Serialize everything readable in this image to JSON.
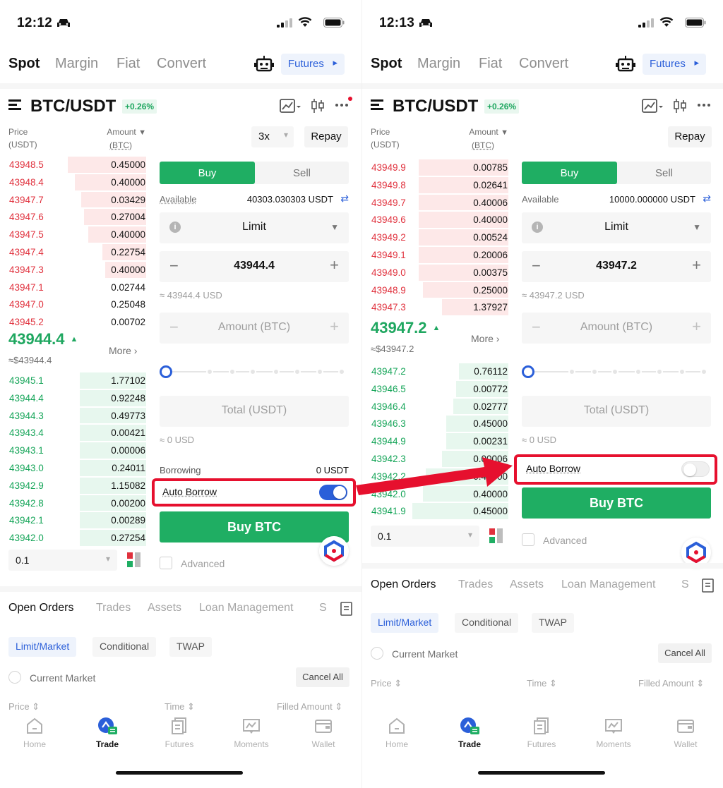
{
  "left": {
    "status_time": "12:12",
    "nav": {
      "tabs": [
        "Spot",
        "Margin",
        "Fiat",
        "Convert"
      ],
      "futures_label": "Futures"
    },
    "pair": "BTC/USDT",
    "change": "+0.26%",
    "orderbook_header": {
      "price_label": "Price",
      "price_unit": "(USDT)",
      "amount_label": "Amount",
      "amount_unit": "(BTC)"
    },
    "asks": [
      {
        "price": "43948.5",
        "amount": "0.45000",
        "depth": 0.57
      },
      {
        "price": "43948.4",
        "amount": "0.40000",
        "depth": 0.52
      },
      {
        "price": "43947.7",
        "amount": "0.03429",
        "depth": 0.47
      },
      {
        "price": "43947.6",
        "amount": "0.27004",
        "depth": 0.45
      },
      {
        "price": "43947.5",
        "amount": "0.40000",
        "depth": 0.42
      },
      {
        "price": "43947.4",
        "amount": "0.22754",
        "depth": 0.32
      },
      {
        "price": "43947.3",
        "amount": "0.40000",
        "depth": 0.3
      },
      {
        "price": "43947.1",
        "amount": "0.02744",
        "depth": 0.0
      },
      {
        "price": "43947.0",
        "amount": "0.25048",
        "depth": 0.0
      },
      {
        "price": "43945.2",
        "amount": "0.00702",
        "depth": 0.0
      }
    ],
    "last_price": "43944.4",
    "last_usd": "≈$43944.4",
    "more_label": "More",
    "bids": [
      {
        "price": "43945.1",
        "amount": "1.77102",
        "depth": 0.48
      },
      {
        "price": "43944.4",
        "amount": "0.92248",
        "depth": 0.48
      },
      {
        "price": "43944.3",
        "amount": "0.49773",
        "depth": 0.48
      },
      {
        "price": "43943.4",
        "amount": "0.00421",
        "depth": 0.48
      },
      {
        "price": "43943.1",
        "amount": "0.00006",
        "depth": 0.48
      },
      {
        "price": "43943.0",
        "amount": "0.24011",
        "depth": 0.48
      },
      {
        "price": "43942.9",
        "amount": "1.15082",
        "depth": 0.48
      },
      {
        "price": "43942.8",
        "amount": "0.00200",
        "depth": 0.48
      },
      {
        "price": "43942.1",
        "amount": "0.00289",
        "depth": 0.48
      },
      {
        "price": "43942.0",
        "amount": "0.27254",
        "depth": 0.48
      }
    ],
    "depth_value": "0.1",
    "leverage": "3x",
    "repay": "Repay",
    "buy_tab": "Buy",
    "sell_tab": "Sell",
    "available_label": "Available",
    "available_value": "40303.030303 USDT",
    "order_type": "Limit",
    "price_value": "43944.4",
    "price_usd": "≈ 43944.4 USD",
    "amount_placeholder": "Amount (BTC)",
    "total_placeholder": "Total (USDT)",
    "total_usd": "≈ 0 USD",
    "borrowing_label": "Borrowing",
    "borrowing_value": "0 USDT",
    "auto_borrow_label": "Auto Borrow",
    "auto_borrow_on": true,
    "buy_button": "Buy BTC",
    "advanced_label": "Advanced",
    "bottom_tabs": [
      "Open Orders",
      "Trades",
      "Assets",
      "Loan Management",
      "S"
    ],
    "sub_tabs": [
      "Limit/Market",
      "Conditional",
      "TWAP"
    ],
    "current_market": "Current Market",
    "cancel_all": "Cancel All",
    "columns": [
      "Price",
      "Time",
      "Filled Amount"
    ]
  },
  "right": {
    "status_time": "12:13",
    "nav": {
      "tabs": [
        "Spot",
        "Margin",
        "Fiat",
        "Convert"
      ],
      "futures_label": "Futures"
    },
    "pair": "BTC/USDT",
    "change": "+0.26%",
    "orderbook_header": {
      "price_label": "Price",
      "price_unit": "(USDT)",
      "amount_label": "Amount",
      "amount_unit": "(BTC)"
    },
    "asks": [
      {
        "price": "43949.9",
        "amount": "0.00785",
        "depth": 0.65
      },
      {
        "price": "43949.8",
        "amount": "0.02641",
        "depth": 0.65
      },
      {
        "price": "43949.7",
        "amount": "0.40006",
        "depth": 0.65
      },
      {
        "price": "43949.6",
        "amount": "0.40000",
        "depth": 0.65
      },
      {
        "price": "43949.2",
        "amount": "0.00524",
        "depth": 0.65
      },
      {
        "price": "43949.1",
        "amount": "0.20006",
        "depth": 0.65
      },
      {
        "price": "43949.0",
        "amount": "0.00375",
        "depth": 0.65
      },
      {
        "price": "43948.9",
        "amount": "0.25000",
        "depth": 0.62
      },
      {
        "price": "43947.3",
        "amount": "1.37927",
        "depth": 0.48
      }
    ],
    "last_price": "43947.2",
    "last_usd": "≈$43947.2",
    "more_label": "More",
    "bids": [
      {
        "price": "43947.2",
        "amount": "0.76112",
        "depth": 0.36
      },
      {
        "price": "43946.5",
        "amount": "0.00772",
        "depth": 0.38
      },
      {
        "price": "43946.4",
        "amount": "0.02777",
        "depth": 0.4
      },
      {
        "price": "43946.3",
        "amount": "0.45000",
        "depth": 0.45
      },
      {
        "price": "43944.9",
        "amount": "0.00231",
        "depth": 0.45
      },
      {
        "price": "43942.3",
        "amount": "0.00006",
        "depth": 0.48
      },
      {
        "price": "43942.2",
        "amount": "0.40000",
        "depth": 0.6
      },
      {
        "price": "43942.0",
        "amount": "0.40000",
        "depth": 0.62
      },
      {
        "price": "43941.9",
        "amount": "0.45000",
        "depth": 0.7
      }
    ],
    "depth_value": "0.1",
    "repay": "Repay",
    "buy_tab": "Buy",
    "sell_tab": "Sell",
    "available_label": "Available",
    "available_value": "10000.000000 USDT",
    "order_type": "Limit",
    "price_value": "43947.2",
    "price_usd": "≈ 43947.2 USD",
    "amount_placeholder": "Amount (BTC)",
    "total_placeholder": "Total (USDT)",
    "total_usd": "≈ 0 USD",
    "auto_borrow_label": "Auto Borrow",
    "auto_borrow_on": false,
    "buy_button": "Buy BTC",
    "advanced_label": "Advanced",
    "bottom_tabs": [
      "Open Orders",
      "Trades",
      "Assets",
      "Loan Management",
      "S"
    ],
    "sub_tabs": [
      "Limit/Market",
      "Conditional",
      "TWAP"
    ],
    "current_market": "Current Market",
    "cancel_all": "Cancel All",
    "columns": [
      "Price",
      "Time",
      "Filled Amount"
    ]
  },
  "bottom_nav": [
    "Home",
    "Trade",
    "Futures",
    "Moments",
    "Wallet"
  ],
  "colors": {
    "green": "#1fae63",
    "red": "#e0313d",
    "blue": "#2b5fd9",
    "highlight": "#e6102e"
  },
  "icons": [
    "car-icon",
    "signal-icon",
    "wifi-icon",
    "battery-icon",
    "bot-icon",
    "menu-icon",
    "chart-icon",
    "candle-icon",
    "more-icon",
    "info-icon",
    "swap-icon",
    "home-icon",
    "trade-icon",
    "futures-icon",
    "moments-icon",
    "wallet-icon",
    "doc-icon"
  ]
}
